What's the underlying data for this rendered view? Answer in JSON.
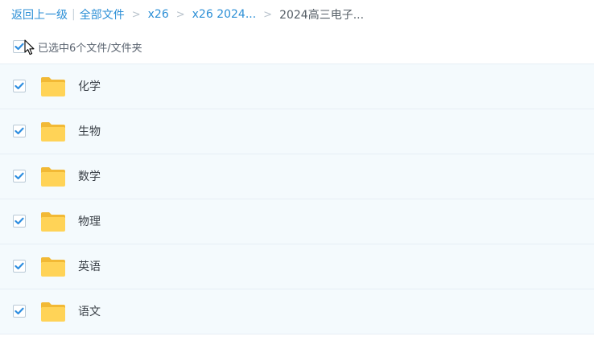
{
  "breadcrumb": {
    "back": "返回上一级",
    "all_files": "全部文件",
    "crumbs": [
      "x26",
      "x26 2024...",
      "2024高三电子..."
    ]
  },
  "selection": {
    "text": "已选中6个文件/文件夹",
    "all_checked": true
  },
  "files": [
    {
      "name": "化学",
      "checked": true
    },
    {
      "name": "生物",
      "checked": true
    },
    {
      "name": "数学",
      "checked": true
    },
    {
      "name": "物理",
      "checked": true
    },
    {
      "name": "英语",
      "checked": true
    },
    {
      "name": "语文",
      "checked": true
    }
  ],
  "colors": {
    "link": "#2c8fd6",
    "check": "#2e8ee0",
    "row_bg": "#f4fafd",
    "folder": "#ffd357"
  },
  "icons": {
    "folder": "folder-icon",
    "check": "checkmark-icon",
    "cursor": "mouse-pointer-icon"
  }
}
